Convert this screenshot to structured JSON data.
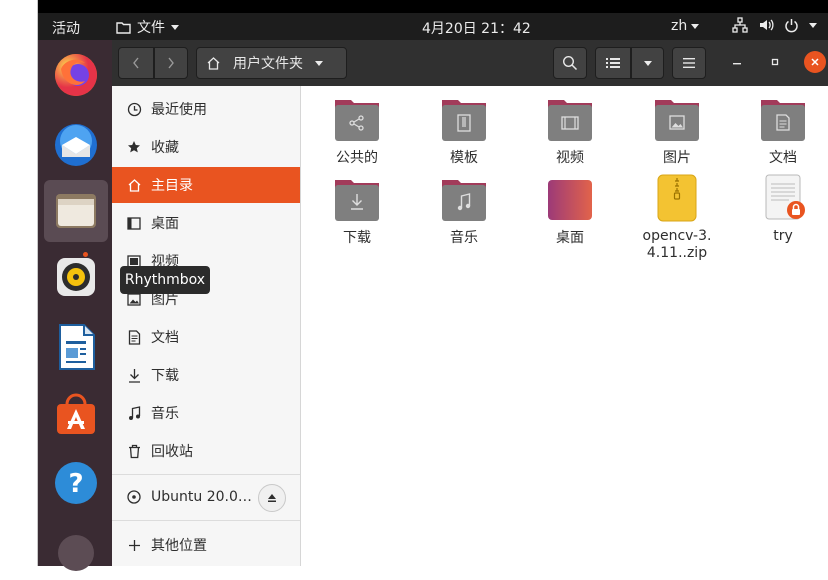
{
  "topbar": {
    "activities": "活动",
    "app_menu": "文件",
    "clock": "4月20日  21：42",
    "lang": "zh"
  },
  "header": {
    "location": "用户文件夹"
  },
  "tooltip": "Rhythmbox",
  "sidebar": {
    "items": [
      {
        "label": "最近使用",
        "icon": "clock-icon"
      },
      {
        "label": "收藏",
        "icon": "star-icon"
      },
      {
        "label": "主目录",
        "icon": "home-icon"
      },
      {
        "label": "桌面",
        "icon": "desktop-icon"
      },
      {
        "label": "视频",
        "icon": "video-icon"
      },
      {
        "label": "图片",
        "icon": "picture-icon"
      },
      {
        "label": "文档",
        "icon": "document-icon"
      },
      {
        "label": "下载",
        "icon": "download-icon"
      },
      {
        "label": "音乐",
        "icon": "music-icon"
      },
      {
        "label": "回收站",
        "icon": "trash-icon"
      }
    ],
    "drive": "Ubuntu 20.0…",
    "other_locations": "其他位置"
  },
  "files": [
    {
      "name": "公共的",
      "type": "folder-share"
    },
    {
      "name": "模板",
      "type": "folder-template"
    },
    {
      "name": "视频",
      "type": "folder-video"
    },
    {
      "name": "图片",
      "type": "folder-picture"
    },
    {
      "name": "文档",
      "type": "folder-document"
    },
    {
      "name": "下载",
      "type": "folder-download"
    },
    {
      "name": "音乐",
      "type": "folder-music"
    },
    {
      "name": "桌面",
      "type": "folder-desktop"
    },
    {
      "name": "opencv-3.4.11..zip",
      "type": "zip-archive"
    },
    {
      "name": "try",
      "type": "locked-text-file"
    }
  ],
  "colors": {
    "accent": "#e95420",
    "dock": "#3a2b33",
    "folder_tab": "#a23b5a",
    "folder_body": "#7f7f7f"
  }
}
